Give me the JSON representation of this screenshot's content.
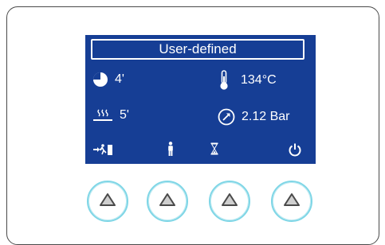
{
  "screen": {
    "title": "User-defined",
    "time_1": "4'",
    "time_2": "5'",
    "temperature": "134°C",
    "pressure": "2.12 Bar"
  },
  "icons": {
    "pie": "pie-timer-icon",
    "heat": "heat-drying-icon",
    "thermometer": "thermometer-icon",
    "gauge": "pressure-gauge-icon",
    "exit": "exit-door-icon",
    "person": "person-icon",
    "hourglass": "hourglass-icon",
    "power": "power-icon",
    "buttons": "triangle-up-icon"
  },
  "colors": {
    "screen_bg": "#163e95",
    "button_ring": "#7fd6e6"
  }
}
